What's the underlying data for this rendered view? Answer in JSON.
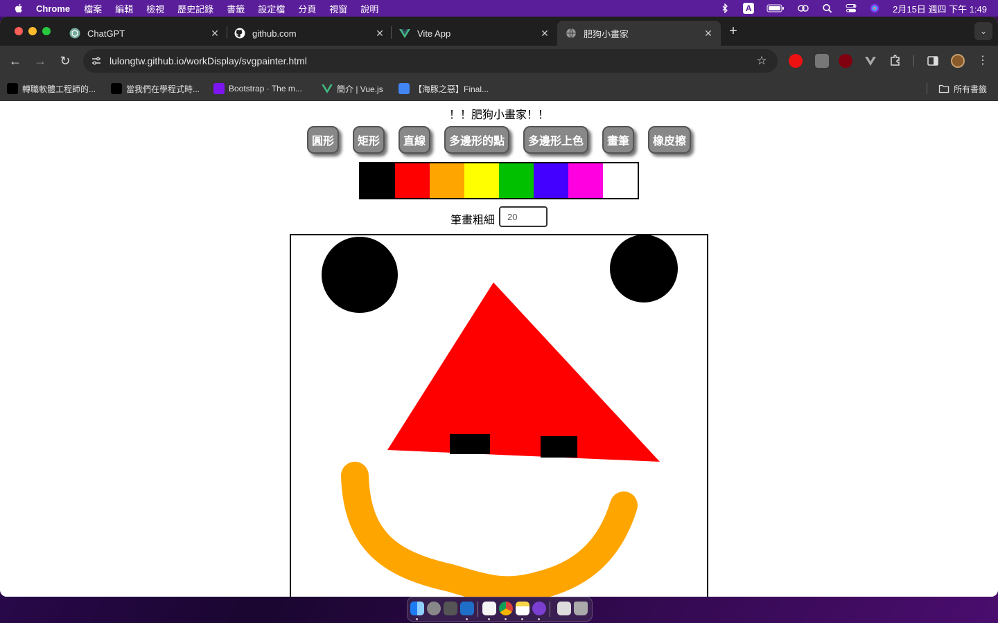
{
  "menubar": {
    "app_name": "Chrome",
    "menus": [
      "檔案",
      "編輯",
      "檢視",
      "歷史記錄",
      "書籤",
      "設定檔",
      "分頁",
      "視窗",
      "說明"
    ],
    "input_method": "A",
    "clock": "2月15日 週四 下午 1:49"
  },
  "tabs": [
    {
      "title": "ChatGPT",
      "icon": "chatgpt-icon"
    },
    {
      "title": "github.com",
      "icon": "github-icon"
    },
    {
      "title": "Vite App",
      "icon": "vue-icon"
    },
    {
      "title": "肥狗小畫家",
      "icon": "globe-icon",
      "active": true
    }
  ],
  "toolbar": {
    "url": "lulongtw.github.io/workDisplay/svgpainter.html"
  },
  "bookmarks": {
    "items": [
      {
        "label": "轉職軟體工程師的...",
        "icon": "medium-icon"
      },
      {
        "label": "當我們在學程式時...",
        "icon": "medium-icon"
      },
      {
        "label": "Bootstrap · The m...",
        "icon": "bootstrap-icon"
      },
      {
        "label": "簡介 | Vue.js",
        "icon": "vue-icon"
      },
      {
        "label": "【海豚之惡】Final...",
        "icon": "docs-icon"
      }
    ],
    "all_bookmarks": "所有書籤"
  },
  "page": {
    "heading": "！！肥狗小畫家！！",
    "tools": [
      "圓形",
      "矩形",
      "直線",
      "多邊形的點",
      "多邊形上色",
      "畫筆",
      "橡皮擦"
    ],
    "palette": [
      "#000000",
      "#ff0000",
      "#ffa500",
      "#ffff00",
      "#00c000",
      "#4400ff",
      "#ff00e0",
      "#ffffff"
    ],
    "thickness_label": "筆畫粗細",
    "thickness_value": "20"
  },
  "colors": {
    "triangle": "#ff0000",
    "stroke": "#ffa500",
    "shape": "#000000"
  }
}
